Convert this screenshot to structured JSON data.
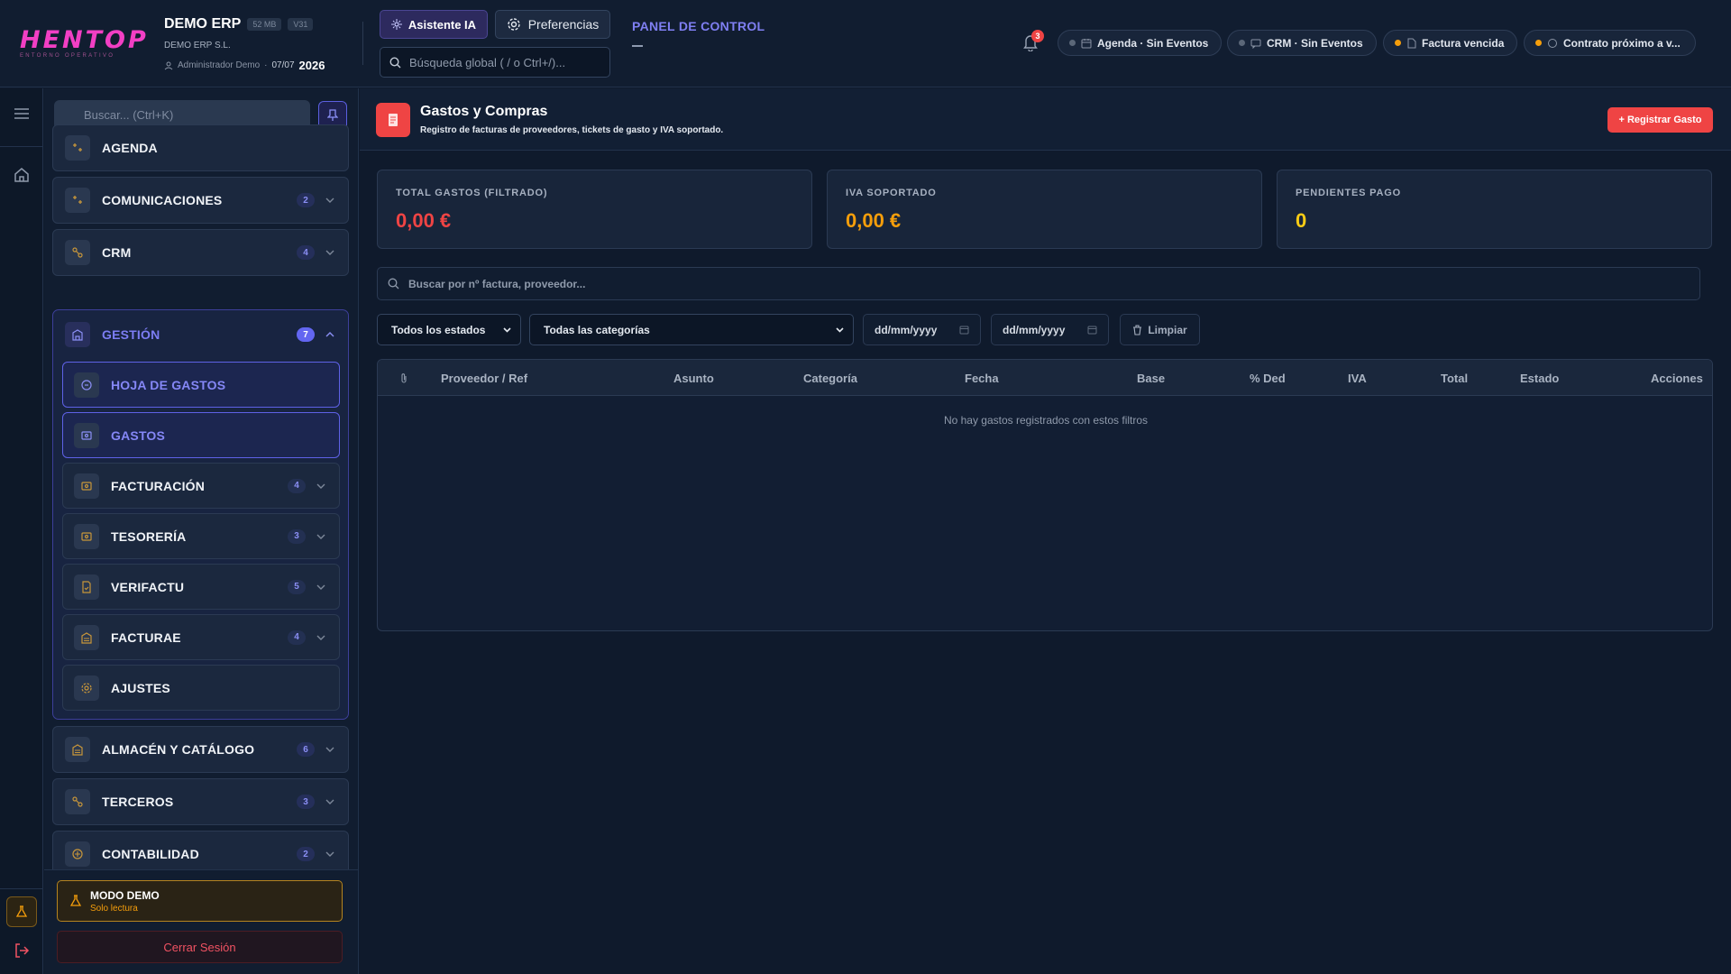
{
  "app": {
    "logo": "HENTOP",
    "logo_sub": "ENTORNO OPERATIVO",
    "company_name": "DEMO ERP",
    "size_chip": "52 MB",
    "version_chip": "V31",
    "company_legal": "DEMO ERP S.L.",
    "user": "Administrador Demo",
    "separator": "·",
    "date": "07/07",
    "year": "2026"
  },
  "topbar": {
    "ai_button": "Asistente IA",
    "prefs_button": "Preferencias",
    "global_search_placeholder": "Búsqueda global ( / o Ctrl+/)...",
    "panel_link": "PANEL DE CONTROL",
    "panel_sub": "—",
    "bell_count": "3",
    "pills": [
      {
        "label": "Agenda · Sin Eventos",
        "dot": "#5b6778"
      },
      {
        "label": "CRM · Sin Eventos",
        "dot": "#5b6778"
      },
      {
        "label": "Factura vencida",
        "dot": "#f59e0b"
      },
      {
        "label": "Contrato próximo a v...",
        "dot": "#f59e0b"
      }
    ]
  },
  "sidebar": {
    "search_placeholder": "Buscar... (Ctrl+K)",
    "items": [
      {
        "label": "AGENDA"
      },
      {
        "label": "COMUNICACIONES",
        "badge": "2"
      },
      {
        "label": "CRM",
        "badge": "4"
      },
      {
        "label": "GESTIÓN",
        "badge": "7"
      },
      {
        "label": "ALMACÉN Y CATÁLOGO",
        "badge": "6"
      },
      {
        "label": "TERCEROS",
        "badge": "3"
      },
      {
        "label": "CONTABILIDAD",
        "badge": "2"
      }
    ],
    "subitems": [
      {
        "label": "HOJA DE GASTOS"
      },
      {
        "label": "GASTOS"
      },
      {
        "label": "FACTURACIÓN",
        "badge": "4"
      },
      {
        "label": "TESORERÍA",
        "badge": "3"
      },
      {
        "label": "VERIFACTU",
        "badge": "5"
      },
      {
        "label": "FACTURAE",
        "badge": "4"
      },
      {
        "label": "AJUSTES"
      }
    ],
    "demo_title": "MODO DEMO",
    "demo_sub": "Solo lectura",
    "logout": "Cerrar Sesión"
  },
  "page": {
    "title": "Gastos y Compras",
    "subtitle": "Registro de facturas de proveedores, tickets de gasto y IVA soportado.",
    "add_button": "+ Registrar Gasto",
    "cards": [
      {
        "label": "TOTAL GASTOS (FILTRADO)",
        "value": "0,00 €",
        "color": "#ef4444"
      },
      {
        "label": "IVA SOPORTADO",
        "value": "0,00 €",
        "color": "#f59e0b"
      },
      {
        "label": "PENDIENTES PAGO",
        "value": "0",
        "color": "#facc15"
      }
    ],
    "search_placeholder": "Buscar por nº factura, proveedor...",
    "status_select": "Todos los estados",
    "category_select": "Todas las categorías",
    "date_from": "dd/mm/yyyy",
    "date_to": "dd/mm/yyyy",
    "clear_button": "Limpiar",
    "columns": [
      "Proveedor / Ref",
      "Asunto",
      "Categoría",
      "Fecha",
      "Base",
      "% Ded",
      "IVA",
      "Total",
      "Estado",
      "Acciones"
    ],
    "empty_message": "No hay gastos registrados con estos filtros"
  }
}
